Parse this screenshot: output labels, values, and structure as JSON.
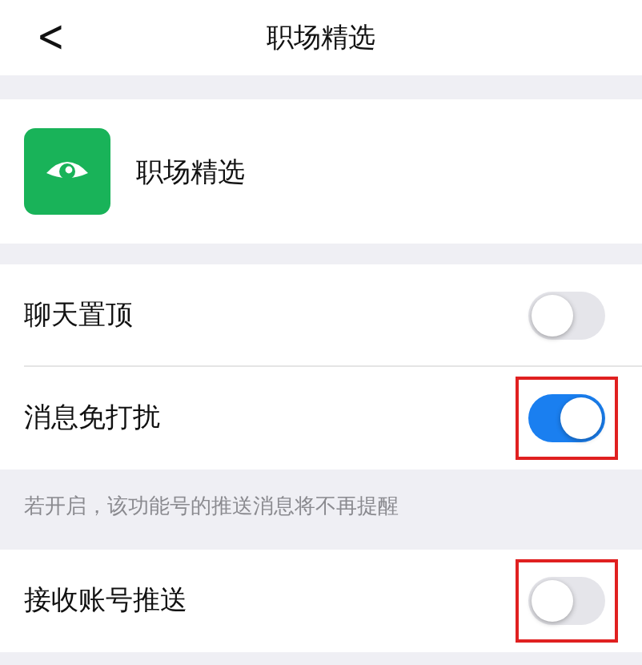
{
  "header": {
    "back": "<",
    "title": "职场精选"
  },
  "account": {
    "name": "职场精选"
  },
  "settings": [
    {
      "label": "聊天置顶",
      "on": false,
      "highlighted": false
    },
    {
      "label": "消息免打扰",
      "on": true,
      "highlighted": true
    }
  ],
  "note": "若开启，该功能号的推送消息将不再提醒",
  "settings_2": [
    {
      "label": "接收账号推送",
      "on": false,
      "highlighted": true
    }
  ]
}
